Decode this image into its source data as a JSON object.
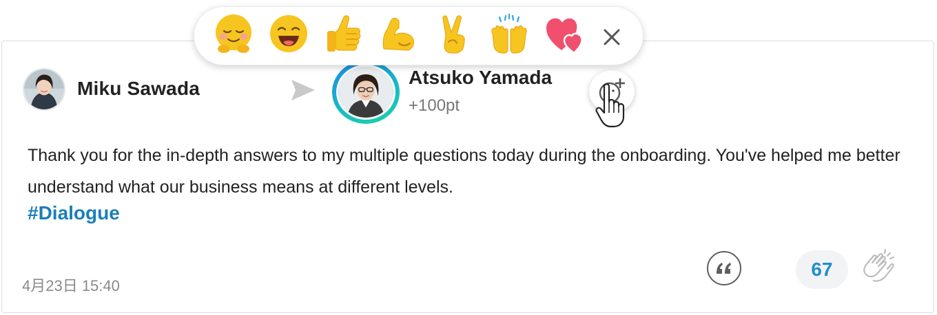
{
  "post": {
    "sender": {
      "name": "Miku Sawada"
    },
    "recipient": {
      "name": "Atsuko Yamada",
      "points": "+100pt"
    },
    "message": "Thank you for the in-depth answers to my multiple questions today during the onboarding. You've helped me better understand what our business means at different levels.",
    "hashtag": "#Dialogue",
    "timestamp": "4月23日 15:40",
    "clap_count": "67"
  },
  "reaction_picker": {
    "emojis": [
      "relieved-smile",
      "grinning-face",
      "thumbs-up",
      "flexed-biceps",
      "victory-hand",
      "raising-hands",
      "two-hearts"
    ],
    "close_icon": "close-icon"
  },
  "colors": {
    "accent": "#1f8fca",
    "hashtag": "#1a7eb9",
    "avatar_ring_start": "#1e88e5",
    "avatar_ring_end": "#1bd3a6",
    "emoji_yellow": "#f7c520",
    "heart": "#f0506e"
  }
}
